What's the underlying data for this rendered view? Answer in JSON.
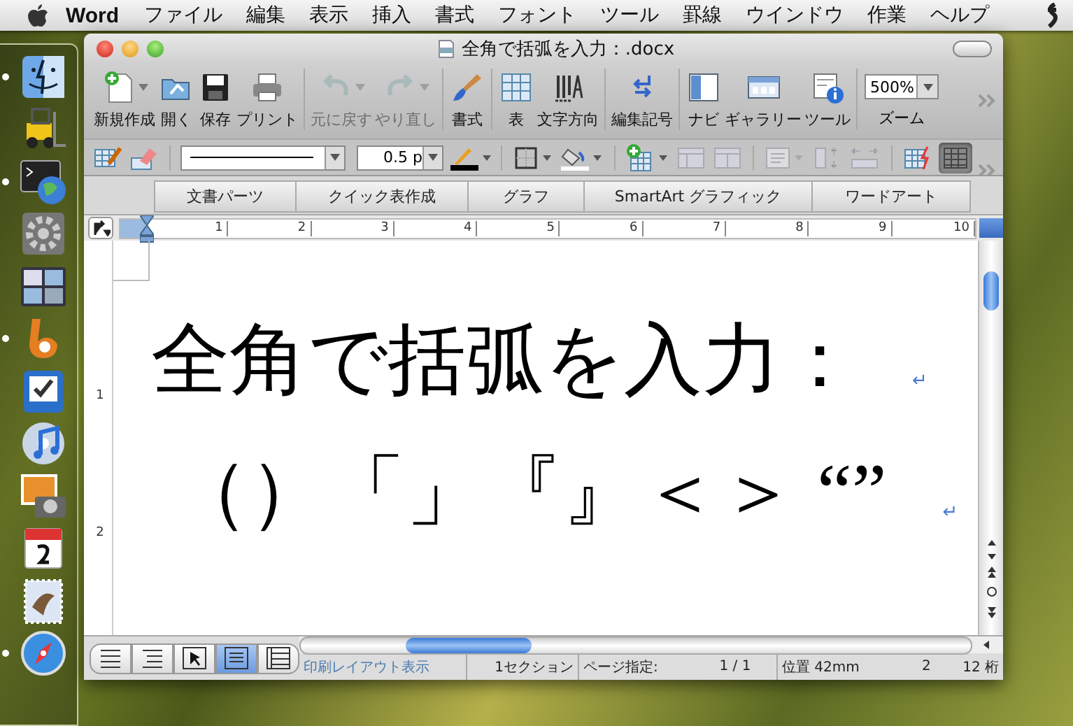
{
  "menubar": {
    "app": "Word",
    "items": [
      "ファイル",
      "編集",
      "表示",
      "挿入",
      "書式",
      "フォント",
      "ツール",
      "罫線",
      "ウインドウ",
      "作業",
      "ヘルプ"
    ]
  },
  "dock": {
    "items": [
      {
        "kind": "finder",
        "running": true
      },
      {
        "kind": "forklift",
        "running": false
      },
      {
        "kind": "terminal",
        "running": true
      },
      {
        "kind": "gear",
        "running": false
      },
      {
        "kind": "windows",
        "running": false
      },
      {
        "kind": "swirl",
        "running": true
      },
      {
        "kind": "tray",
        "running": false
      },
      {
        "kind": "music",
        "running": false
      },
      {
        "kind": "photo",
        "running": false
      },
      {
        "kind": "calendar",
        "running": false
      },
      {
        "kind": "mail",
        "running": false
      },
      {
        "kind": "compass",
        "running": true
      }
    ]
  },
  "window": {
    "title": "全角で括弧を入力：.docx"
  },
  "toolbar": {
    "groups": [
      [
        {
          "kind": "new",
          "label": "新規作成",
          "dropdown": true,
          "disabled": false
        },
        {
          "kind": "open",
          "label": "開く",
          "dropdown": false,
          "disabled": false
        },
        {
          "kind": "save",
          "label": "保存",
          "dropdown": false,
          "disabled": false
        },
        {
          "kind": "print",
          "label": "プリント",
          "dropdown": false,
          "disabled": false
        }
      ],
      [
        {
          "kind": "undo",
          "label": "元に戻す",
          "dropdown": true,
          "disabled": true
        },
        {
          "kind": "redo",
          "label": "やり直し",
          "dropdown": true,
          "disabled": true
        }
      ],
      [
        {
          "kind": "brush",
          "label": "書式",
          "dropdown": false,
          "disabled": false
        }
      ],
      [
        {
          "kind": "table",
          "label": "表",
          "dropdown": false,
          "disabled": false
        },
        {
          "kind": "direction",
          "label": "文字方向",
          "dropdown": false,
          "disabled": false
        }
      ],
      [
        {
          "kind": "marks",
          "label": "編集記号",
          "dropdown": false,
          "disabled": false
        }
      ],
      [
        {
          "kind": "navi",
          "label": "ナビ",
          "dropdown": false,
          "disabled": false
        },
        {
          "kind": "gallery",
          "label": "ギャラリー",
          "dropdown": false,
          "disabled": false
        },
        {
          "kind": "tools",
          "label": "ツール",
          "dropdown": false,
          "disabled": false
        }
      ]
    ],
    "zoom": {
      "value": "500%",
      "label": "ズーム"
    }
  },
  "format_toolbar": {
    "line_weight": "0.5 p",
    "grid_pressed": true
  },
  "ribbon_tabs": [
    "文書パーツ",
    "クイック表作成",
    "グラフ",
    "SmartArt グラフィック",
    "ワードアート"
  ],
  "ruler": {
    "numbers": [
      "1",
      "2",
      "3",
      "4",
      "5",
      "6",
      "7",
      "8",
      "9",
      "10"
    ]
  },
  "vertical_ruler": {
    "numbers": [
      "1",
      "2"
    ]
  },
  "document": {
    "paragraphs": [
      {
        "text": "全角で括弧を入力：",
        "mark": "↵"
      },
      {
        "text": "（）「」『』＜＞ “”",
        "mark": "↵"
      }
    ]
  },
  "view_buttons": [
    {
      "kind": "draft",
      "selected": false
    },
    {
      "kind": "outline",
      "selected": false
    },
    {
      "kind": "publishing",
      "selected": false
    },
    {
      "kind": "print",
      "selected": true
    },
    {
      "kind": "notebook",
      "selected": false
    }
  ],
  "status_bar": {
    "view": "印刷レイアウト表示",
    "section": "1セクション",
    "page_label": "ページ指定:",
    "page": "1 / 1",
    "position": "位置 42mm",
    "line": "2",
    "column": "12 桁"
  }
}
